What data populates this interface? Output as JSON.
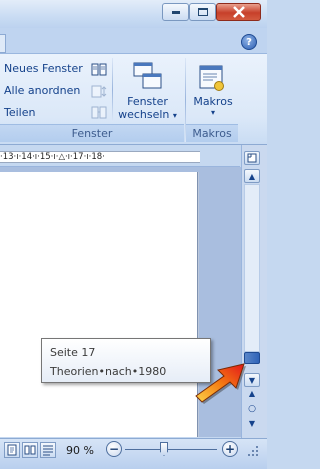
{
  "title_bar": {
    "minimize_icon": "minimize-icon",
    "maximize_icon": "maximize-icon",
    "close_icon": "close-icon",
    "close_color": "#c7402a"
  },
  "tab_strip": {
    "help_label": "?"
  },
  "ribbon": {
    "fenster_group": {
      "label": "Fenster",
      "new_window": "Neues Fenster",
      "arrange_all": "Alle anordnen",
      "split": "Teilen",
      "switch_windows_line1": "Fenster",
      "switch_windows_line2": "wechseln",
      "dropdown_arrow": "▾"
    },
    "makros_group": {
      "label": "Makros",
      "button_label": "Makros",
      "dropdown_arrow": "▾"
    }
  },
  "ruler": {
    "text": "·13·ı·14·ı·15·ı·△·ı·17·ı·18·"
  },
  "scrollbar": {
    "up_arrow": "▲",
    "down_arrow": "▼",
    "prev_arrow": "▲",
    "next_arrow": "▼",
    "browse_object": "○"
  },
  "tooltip": {
    "page": "Seite 17",
    "heading": "Theorien•nach•1980"
  },
  "status_bar": {
    "zoom_level": "90 %",
    "zoom_out": "−",
    "zoom_in": "+"
  },
  "colors": {
    "accent": "#15428b",
    "ribbon_bg": "#dbe8f8",
    "arrow_orange": "#f57b12"
  }
}
